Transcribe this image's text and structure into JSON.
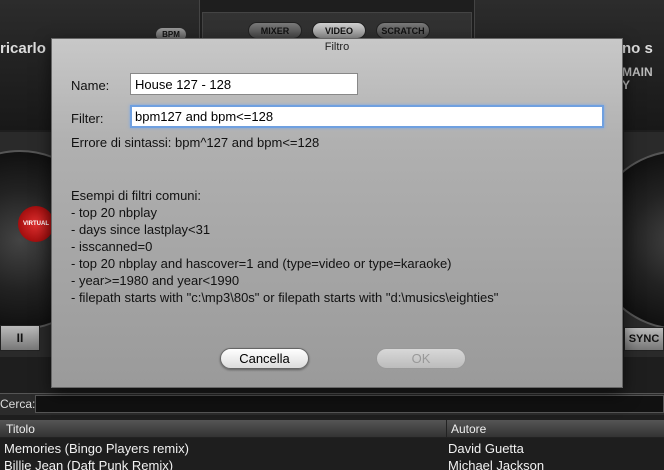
{
  "background": {
    "deck_left_title": "ricarlo",
    "deck_right_title": "no s",
    "deck_right_subtitle_line1": "MAIN",
    "deck_right_subtitle_line2": "Y",
    "bpm_badge": "BPM",
    "modes": [
      "MIXER",
      "VIDEO",
      "SCRATCH"
    ],
    "active_mode": "VIDEO",
    "virtual_label": "VIRTUAL",
    "pause_label": "II",
    "sync_label": "SYNC",
    "search_label": "Cerca:",
    "search_value": "",
    "columns": [
      "Titolo",
      "Autore"
    ],
    "rows": [
      {
        "title": "Memories (Bingo Players remix)",
        "author": "David Guetta"
      },
      {
        "title": "Billie Jean (Daft Punk Remix)",
        "author": "Michael Jackson"
      }
    ]
  },
  "dialog": {
    "title": "Filtro",
    "name_label": "Name:",
    "name_value": "House 127 - 128",
    "filter_label": "Filter:",
    "filter_value": "bpm127 and bpm<=128",
    "error_text": "Errore di sintassi: bpm^127 and bpm<=128",
    "examples_heading": "Esempi di filtri comuni:",
    "examples": [
      "- top 20 nbplay",
      "- days since lastplay<31",
      "- isscanned=0",
      "- top 20 nbplay and hascover=1 and (type=video or type=karaoke)",
      "- year>=1980 and year<1990",
      "- filepath starts with \"c:\\mp3\\80s\" or filepath starts with \"d:\\musics\\eighties\""
    ],
    "cancel_label": "Cancella",
    "ok_label": "OK"
  }
}
